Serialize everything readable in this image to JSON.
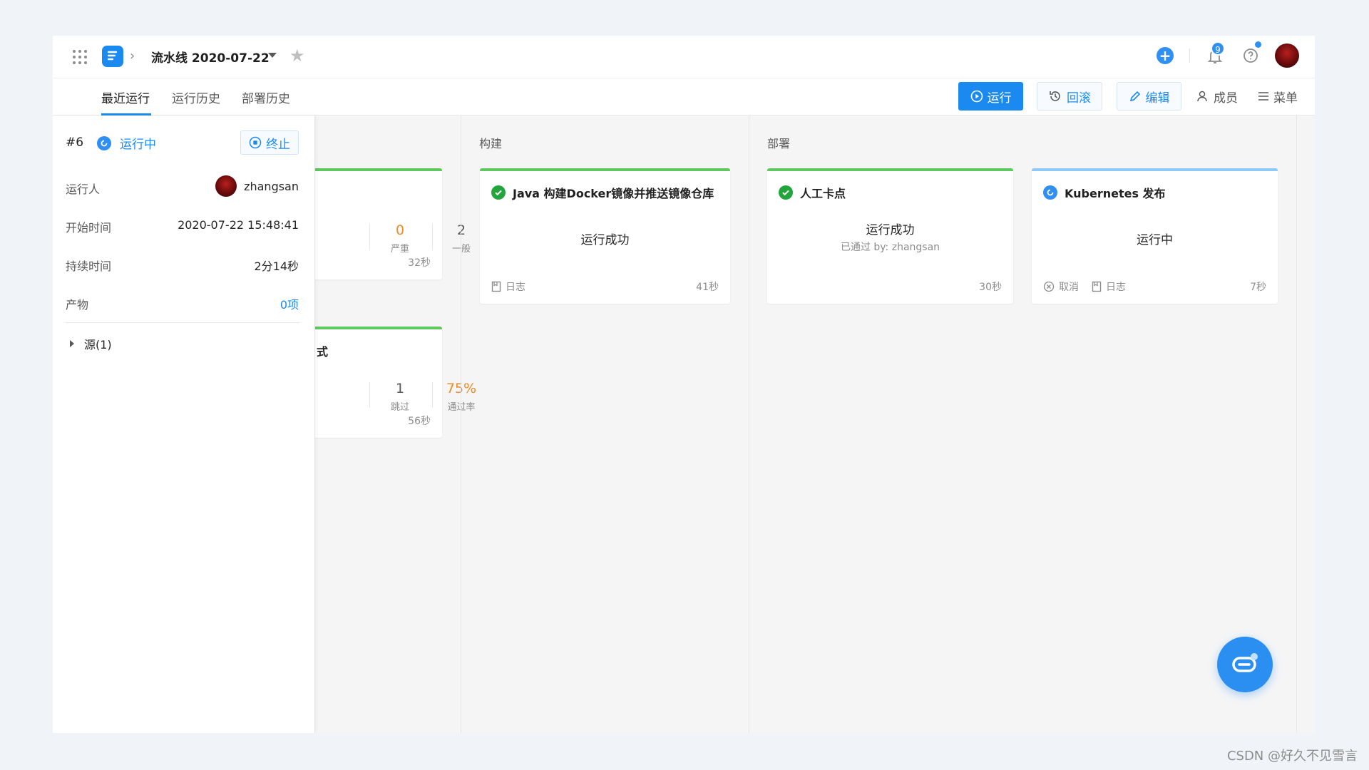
{
  "header": {
    "pipeline_title": "流水线 2020-07-22",
    "notification_count": "9"
  },
  "tabs": [
    {
      "label": "最近运行",
      "active": true
    },
    {
      "label": "运行历史",
      "active": false
    },
    {
      "label": "部署历史",
      "active": false
    }
  ],
  "toolbar": {
    "run_label": "运行",
    "rollback_label": "回滚",
    "edit_label": "编辑",
    "members_label": "成员",
    "menu_label": "菜单"
  },
  "run_panel": {
    "run_number": "#6",
    "state_label": "运行中",
    "stop_label": "终止",
    "fields": [
      {
        "label": "运行人",
        "value": "zhangsan"
      },
      {
        "label": "开始时间",
        "value": "2020-07-22 15:48:41"
      },
      {
        "label": "持续时间",
        "value": "2分14秒"
      },
      {
        "label": "产物",
        "value": "0项"
      }
    ],
    "source_label": "源(1)"
  },
  "hidden_stage": {
    "card1": {
      "metrics": [
        {
          "value": "0",
          "label": "严重"
        },
        {
          "value": "2",
          "label": "一般"
        }
      ],
      "duration": "32秒"
    },
    "card2": {
      "title_fragment": "式",
      "metrics": [
        {
          "value": "1",
          "label": "跳过"
        },
        {
          "value": "75%",
          "label": "通过率"
        }
      ],
      "duration": "56秒"
    }
  },
  "stages": [
    {
      "title": "构建",
      "job": {
        "title": "Java 构建Docker镜像并推送镜像仓库",
        "status": "运行成功",
        "log_label": "日志",
        "duration": "41秒"
      }
    },
    {
      "title": "部署",
      "jobs": [
        {
          "title": "人工卡点",
          "status": "运行成功",
          "sub": "已通过 by: zhangsan",
          "duration": "30秒"
        },
        {
          "title": "Kubernetes 发布",
          "status": "运行中",
          "cancel_label": "取消",
          "log_label": "日志",
          "duration": "7秒"
        }
      ]
    }
  ],
  "watermark": "CSDN @好久不见雪言",
  "colors": {
    "accent": "#1b8af0",
    "success": "#22a63c",
    "success_bar": "#5fc85f",
    "running_bar": "#8fc9f7",
    "warning": "#f08a24"
  },
  "icons": [
    "apps-grid-icon",
    "logo-icon",
    "chevron-right-icon",
    "caret-down-icon",
    "star-icon",
    "plus-icon",
    "bell-icon",
    "help-icon",
    "play-icon",
    "history-icon",
    "edit-icon",
    "user-icon",
    "menu-icon",
    "stop-icon",
    "running-icon",
    "check-icon",
    "log-icon",
    "cancel-icon",
    "chat-icon"
  ]
}
